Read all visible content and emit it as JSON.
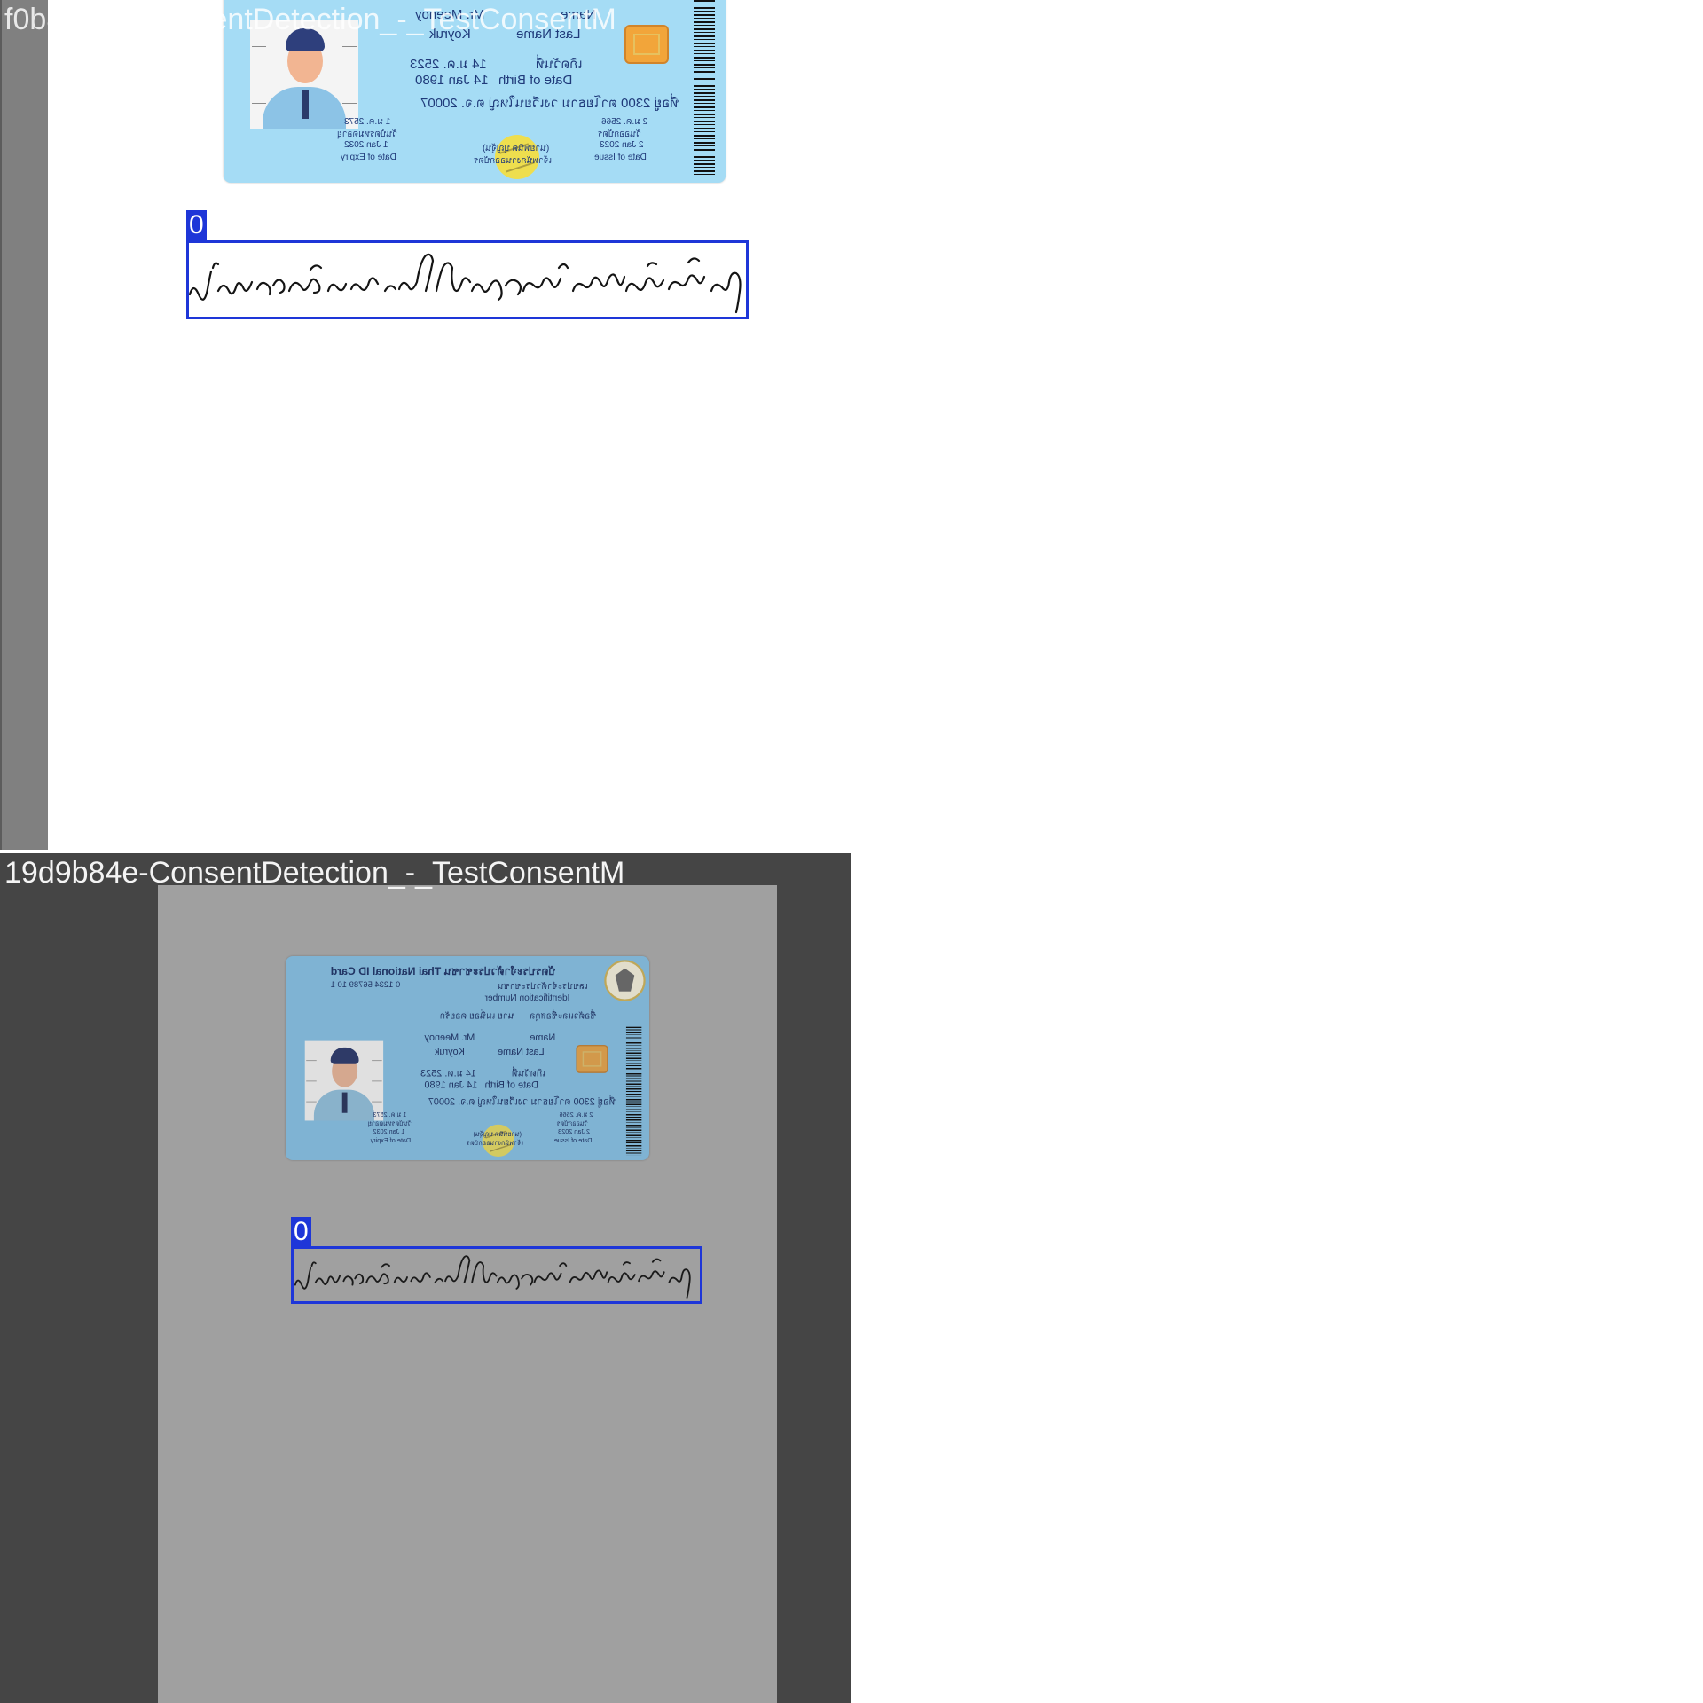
{
  "panels": [
    {
      "title": "f0b8ead8-ConsentDetection_-_TestConsentM",
      "detection": {
        "label": "0"
      }
    },
    {
      "title": "19d9b84e-ConsentDetection_-_TestConsentM",
      "detection": {
        "label": "0"
      }
    }
  ],
  "id_card": {
    "header": "บัตรประจำตัวประชาชน Thai National ID Card",
    "id_number": "0 1234 56789 10 1",
    "id_label_th": "เลขประจำตัวประชาชน",
    "id_label_en": "Identification Number",
    "name_th_label": "ชื่อตัวและชื่อสกุล",
    "name_th": "นาย เมนิ่อย คอยรัก",
    "name_label": "Name",
    "name_value": "Mr. Meenoy",
    "last_name_label": "Last Name",
    "last_name_value": "Koyruk",
    "dob_th_label": "เกิดวันที่",
    "dob_th": "14 ม.ค. 2523",
    "dob_label": "Date of Birth",
    "dob_value": "14 Jan 1980",
    "address": "ที่อยู่ 2300 ตาโยธาม วงเวียนใหญ่ ต.จ. 20007",
    "issue_th": "2 ม.ค. 2566",
    "issue_th_label": "วันออกบัตร",
    "issue_value": "2 Jan 2023",
    "issue_label": "Date of Issue",
    "expiry_th": "1 ม.ค. 2573",
    "expiry_th_label": "วันบัตรหมดอายุ",
    "expiry_value": "1 Jan 2032",
    "expiry_label": "Date of Expiry",
    "officer_name": "(นายพนิต บุญจุ้น)",
    "officer_title": "เจ้าพนักงานออกบัตร"
  },
  "colors": {
    "detection_box": "#1e36d8",
    "card_background": "#a5dcf5",
    "card_text": "#1f3a7a"
  },
  "icons": [
    "thai-garuda-emblem-icon",
    "chip-icon",
    "barcode-icon",
    "seal-icon"
  ]
}
